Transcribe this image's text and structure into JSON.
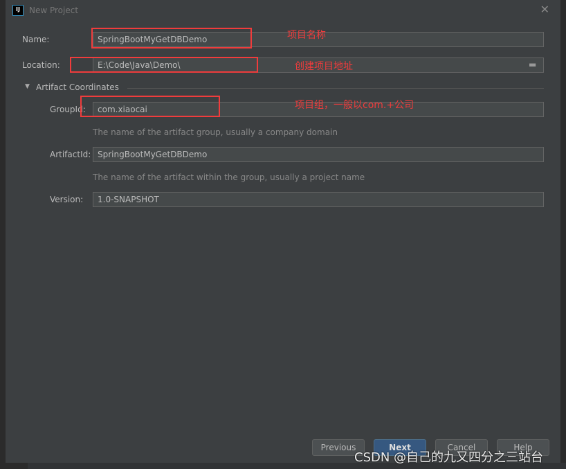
{
  "window": {
    "title": "New Project",
    "close_icon": "close-icon"
  },
  "form": {
    "name_label": "Name:",
    "name_value": "SpringBootMyGetDBDemo",
    "location_label": "Location:",
    "location_value": "E:\\Code\\Java\\Demo\\",
    "section": "Artifact Coordinates",
    "groupid_label": "GroupId:",
    "groupid_value": "com.xiaocai",
    "groupid_hint": "The name of the artifact group, usually a company domain",
    "artifactid_label": "ArtifactId:",
    "artifactid_value": "SpringBootMyGetDBDemo",
    "artifactid_hint": "The name of the artifact within the group, usually a project name",
    "version_label": "Version:",
    "version_value": "1.0-SNAPSHOT"
  },
  "annotations": {
    "name": "项目名称",
    "location": "创建项目地址",
    "group": "项目组，一般以com.+公司"
  },
  "buttons": {
    "previous": "Previous",
    "next": "Next",
    "cancel": "Cancel",
    "help": "Help"
  },
  "watermark": "CSDN @自己的九又四分之三站台",
  "colors": {
    "accent": "#365880",
    "annotation": "#f03c3c"
  }
}
